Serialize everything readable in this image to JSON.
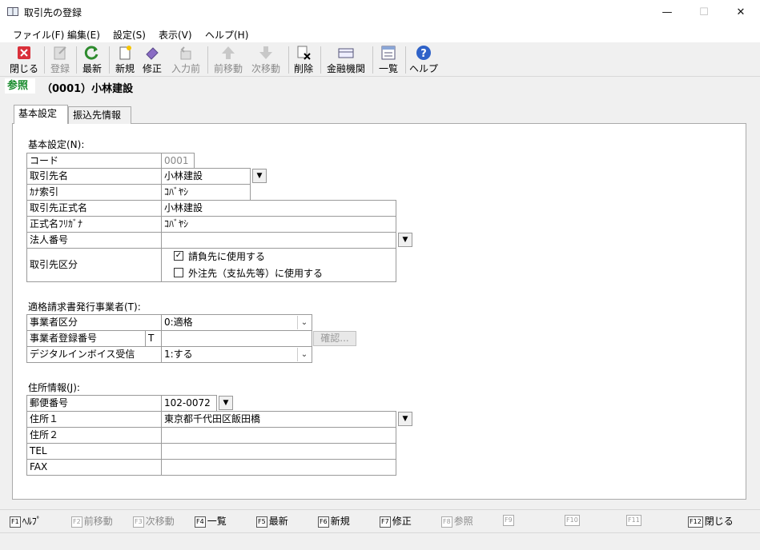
{
  "window": {
    "title": "取引先の登録",
    "minimize": "—",
    "maximize": "☐",
    "close": "✕"
  },
  "menu": [
    "ファイル(F)",
    "編集(E)",
    "設定(S)",
    "表示(V)",
    "ヘルプ(H)"
  ],
  "toolbar": {
    "close": "閉じる",
    "register": "登録",
    "refresh": "最新",
    "new": "新規",
    "edit": "修正",
    "prev_input": "入力前",
    "prev": "前移動",
    "next": "次移動",
    "delete": "削除",
    "bank": "金融機関",
    "list": "一覧",
    "help": "ヘルプ"
  },
  "mode": {
    "badge": "参照",
    "title": "（0001）小林建設"
  },
  "tabs": [
    "基本設定",
    "振込先情報"
  ],
  "basic": {
    "heading": "基本設定(N):",
    "code_label": "コード",
    "code_value": "0001",
    "name_label": "取引先名",
    "name_value": "小林建設",
    "kana_label": "ｶﾅ索引",
    "kana_value": "ｺﾊﾞﾔｼ",
    "formal_label": "取引先正式名",
    "formal_value": "小林建設",
    "formal_kana_label": "正式名ﾌﾘｶﾞﾅ",
    "formal_kana_value": "ｺﾊﾞﾔｼ",
    "corp_label": "法人番号",
    "corp_value": "",
    "type_label": "取引先区分",
    "check1_label": "請負先に使用する",
    "check1": true,
    "check2_label": "外注先（支払先等）に使用する",
    "check2": false
  },
  "invoice": {
    "heading": "適格請求書発行事業者(T):",
    "biz_type_label": "事業者区分",
    "biz_type_value": "0:適格",
    "reg_label": "事業者登録番号",
    "reg_prefix": "T",
    "reg_value": "",
    "confirm_button": "確認...",
    "digital_label": "デジタルインボイス受信",
    "digital_value": "1:する"
  },
  "address": {
    "heading": "住所情報(J):",
    "zip_label": "郵便番号",
    "zip_value": "102-0072",
    "addr1_label": "住所１",
    "addr1_value": "東京都千代田区飯田橋",
    "addr2_label": "住所２",
    "addr2_value": "",
    "tel_label": "TEL",
    "tel_value": "",
    "fax_label": "FAX",
    "fax_value": ""
  },
  "fkeys": [
    {
      "key": "F1",
      "label": "ﾍﾙﾌﾟ",
      "enabled": true
    },
    {
      "key": "F2",
      "label": "前移動",
      "enabled": false
    },
    {
      "key": "F3",
      "label": "次移動",
      "enabled": false
    },
    {
      "key": "F4",
      "label": "一覧",
      "enabled": true
    },
    {
      "key": "F5",
      "label": "最新",
      "enabled": true
    },
    {
      "key": "F6",
      "label": "新規",
      "enabled": true
    },
    {
      "key": "F7",
      "label": "修正",
      "enabled": true
    },
    {
      "key": "F8",
      "label": "参照",
      "enabled": false
    },
    {
      "key": "F9",
      "label": "",
      "enabled": false
    },
    {
      "key": "F10",
      "label": "",
      "enabled": false
    },
    {
      "key": "F11",
      "label": "",
      "enabled": false
    },
    {
      "key": "F12",
      "label": "閉じる",
      "enabled": true
    }
  ]
}
